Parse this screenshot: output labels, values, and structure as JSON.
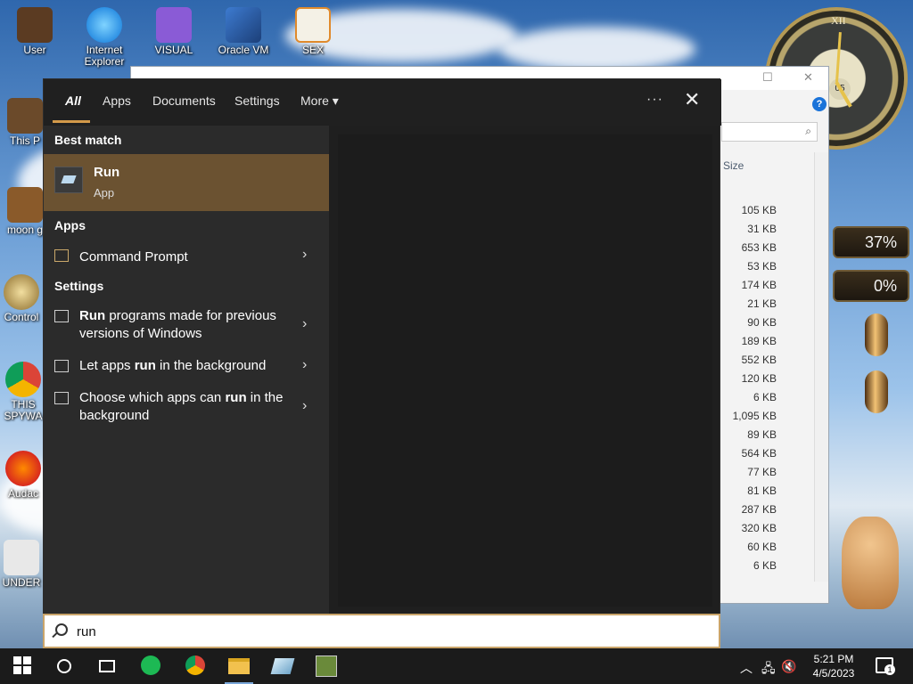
{
  "desktop": {
    "icons": [
      {
        "label": "User"
      },
      {
        "label": "Internet Explorer"
      },
      {
        "label": "VISUAL"
      },
      {
        "label": "Oracle VM"
      },
      {
        "label": "SEX"
      },
      {
        "label": "This P"
      },
      {
        "label": "moon g"
      },
      {
        "label": "Control"
      },
      {
        "label": "THIS SPYWA"
      },
      {
        "label": "Audac"
      },
      {
        "label": "UNDER"
      }
    ],
    "clock": {
      "roman_top": "XII",
      "day": "05"
    },
    "meters": [
      {
        "value": "37%"
      },
      {
        "value": "0%"
      }
    ]
  },
  "explorer": {
    "column_header": "Size",
    "sizes": [
      "105 KB",
      "31 KB",
      "653 KB",
      "53 KB",
      "174 KB",
      "21 KB",
      "90 KB",
      "189 KB",
      "552 KB",
      "120 KB",
      "6 KB",
      "1,095 KB",
      "89 KB",
      "564 KB",
      "77 KB",
      "81 KB",
      "287 KB",
      "320 KB",
      "60 KB",
      "6 KB"
    ],
    "help": "?"
  },
  "search_panel": {
    "tabs": [
      {
        "label": "All"
      },
      {
        "label": "Apps"
      },
      {
        "label": "Documents"
      },
      {
        "label": "Settings"
      },
      {
        "label": "More"
      }
    ],
    "more_chevron": "▾",
    "more_options": "···",
    "close": "✕",
    "best_match": {
      "header": "Best match",
      "name": "Run",
      "type": "App"
    },
    "apps": {
      "header": "Apps",
      "items": [
        {
          "label": "Command Prompt"
        }
      ]
    },
    "settings": {
      "header": "Settings",
      "items": [
        {
          "bold": "Run",
          "rest": " programs made for previous versions of Windows"
        },
        {
          "pre": "Let apps ",
          "bold": "run",
          "post": " in the background"
        },
        {
          "pre": "Choose which apps can ",
          "bold": "run",
          "post": " in the background"
        }
      ]
    },
    "chevron": "›",
    "query": "run"
  },
  "taskbar": {
    "time": "5:21 PM",
    "date": "4/5/2023",
    "notification_count": "1"
  }
}
